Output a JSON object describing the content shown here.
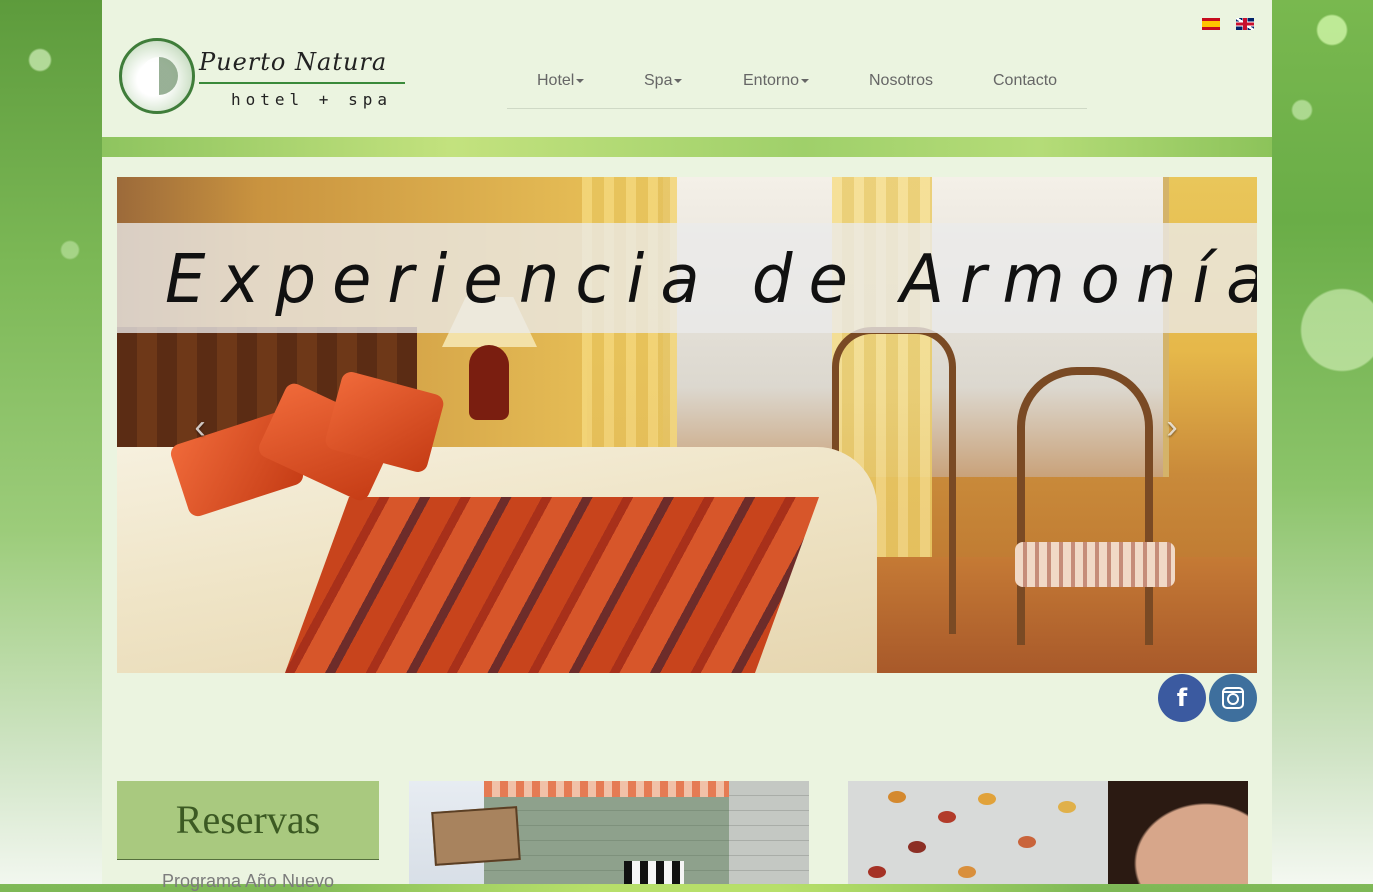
{
  "site": {
    "logo_title": "Puerto Natura",
    "logo_subtitle": "hotel + spa"
  },
  "languages": [
    {
      "code": "es",
      "label": "Español"
    },
    {
      "code": "en",
      "label": "English"
    }
  ],
  "nav": {
    "items": [
      {
        "label": "Hotel",
        "has_dropdown": true
      },
      {
        "label": "Spa",
        "has_dropdown": true
      },
      {
        "label": "Entorno",
        "has_dropdown": true
      },
      {
        "label": "Nosotros",
        "has_dropdown": false
      },
      {
        "label": "Contacto",
        "has_dropdown": false
      }
    ]
  },
  "carousel": {
    "caption": "Experiencia de Armonía",
    "prev_icon": "chevron-left-icon",
    "next_icon": "chevron-right-icon"
  },
  "social": {
    "facebook_glyph": "f",
    "facebook_icon": "facebook-icon",
    "instagram_icon": "instagram-icon"
  },
  "reservas": {
    "title": "Reservas",
    "link_text": "Programa Año Nuevo"
  },
  "colors": {
    "page_panel": "#ebf4e0",
    "reservas_bg": "#a9c97f",
    "reservas_text": "#3c5a23",
    "facebook": "#3b5aa0",
    "instagram": "#3e6f9d",
    "nav_text": "#666666"
  }
}
